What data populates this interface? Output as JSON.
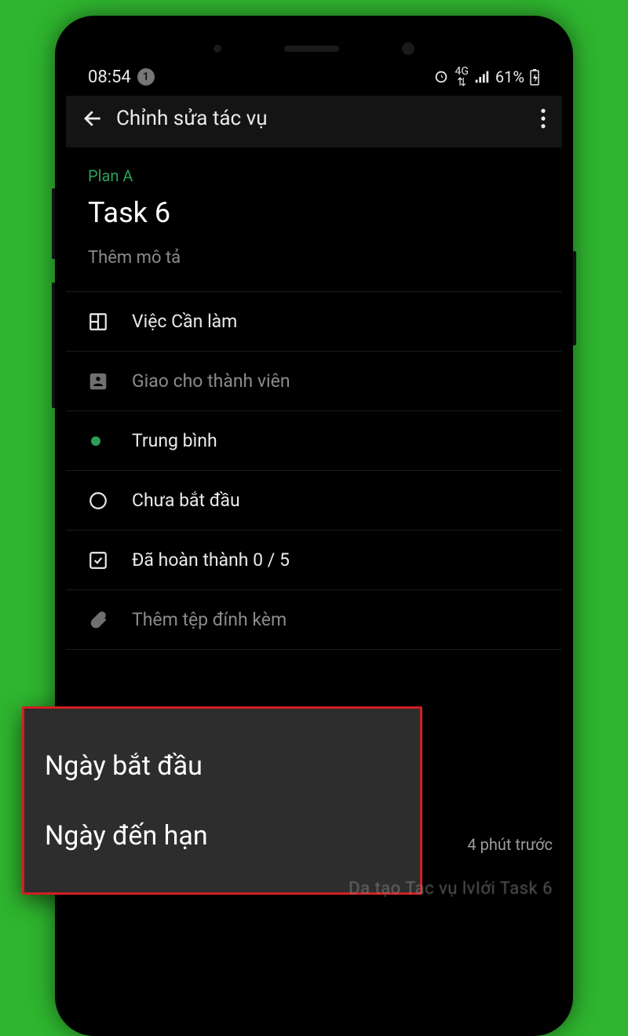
{
  "statusbar": {
    "time": "08:54",
    "notif_count": "1",
    "network_label": "4G",
    "battery": "61%"
  },
  "appbar": {
    "title": "Chỉnh sửa tác vụ"
  },
  "task": {
    "plan": "Plan A",
    "name": "Task 6",
    "desc_placeholder": "Thêm mô tả"
  },
  "rows": {
    "bucket": "Việc Cần làm",
    "assign": "Giao cho thành viên",
    "priority": "Trung bình",
    "status": "Chưa bắt đầu",
    "checklist": "Đã hoàn thành 0 / 5",
    "attach": "Thêm tệp đính kèm"
  },
  "callout": {
    "start": "Ngày bắt đầu",
    "due": "Ngày đến hạn"
  },
  "footer": {
    "ago": "4 phút trước",
    "creator_trunc": "Da tạo Tac vụ lvIới Task 6"
  }
}
